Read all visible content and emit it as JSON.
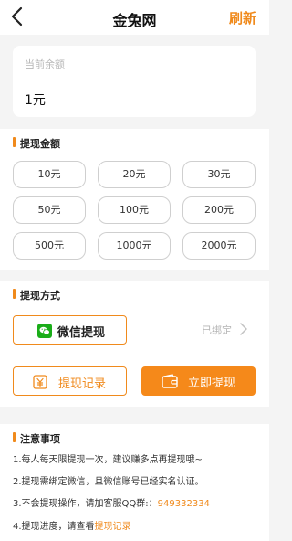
{
  "header": {
    "title": "金兔网",
    "refresh_label": "刷新"
  },
  "balance": {
    "label": "当前余额",
    "value": "1元"
  },
  "amount_section": {
    "title": "提现金额",
    "options": [
      "10元",
      "20元",
      "30元",
      "50元",
      "100元",
      "200元",
      "500元",
      "1000元",
      "2000元"
    ]
  },
  "method_section": {
    "title": "提现方式",
    "wechat_label": "微信提现",
    "bound_status": "已绑定",
    "records_label": "提现记录",
    "withdraw_label": "立即提现"
  },
  "notes_section": {
    "title": "注意事项",
    "notes": [
      "1.每人每天限提现一次，建议赚多点再提现哦~",
      "2.提现需绑定微信，且微信账号已经实名认证。",
      "3.不会提现操作，请加客服QQ群:：",
      "4.提现进度，请查看"
    ],
    "qq_group": "949332334",
    "records_link": "提现记录"
  },
  "colors": {
    "accent": "#f08a1c",
    "wechat": "#1aad19"
  }
}
